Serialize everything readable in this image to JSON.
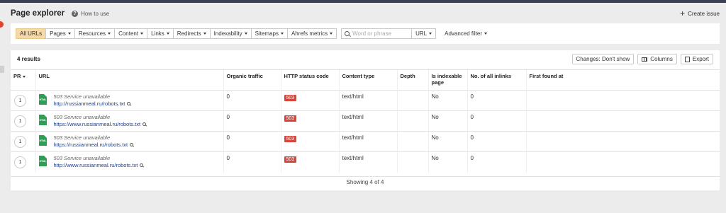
{
  "header": {
    "title": "Page explorer",
    "howto": "How to use",
    "create": "Create issue"
  },
  "filters": {
    "all_urls": "All URLs",
    "pages": "Pages",
    "resources": "Resources",
    "content": "Content",
    "links": "Links",
    "redirects": "Redirects",
    "indexability": "Indexability",
    "sitemaps": "Sitemaps",
    "metrics": "Ahrefs metrics",
    "search_placeholder": "Word or phrase",
    "url_select": "URL",
    "advanced": "Advanced filter"
  },
  "toolbar": {
    "results": "4 results",
    "changes": "Changes: Don't show",
    "columns": "Columns",
    "export": "Export"
  },
  "columns": {
    "pr": "PR",
    "url": "URL",
    "organic": "Organic traffic",
    "status": "HTTP status code",
    "ctype": "Content type",
    "depth": "Depth",
    "indexable": "Is indexable page",
    "inlinks": "No. of all inlinks",
    "first_found": "First found at"
  },
  "rows": [
    {
      "pr": "1",
      "icon_text": "HTML",
      "title": "503 Service unavailable",
      "url": "http://russianmeal.ru/robots.txt",
      "organic": "0",
      "status": "503",
      "ctype": "text/html",
      "depth": "",
      "indexable": "No",
      "inlinks": "0",
      "first_found": ""
    },
    {
      "pr": "1",
      "icon_text": "HTML",
      "title": "503 Service unavailable",
      "url": "https://www.russianmeal.ru/robots.txt",
      "organic": "0",
      "status": "503",
      "ctype": "text/html",
      "depth": "",
      "indexable": "No",
      "inlinks": "0",
      "first_found": ""
    },
    {
      "pr": "1",
      "icon_text": "HTML",
      "title": "503 Service unavailable",
      "url": "https://russianmeal.ru/robots.txt",
      "organic": "0",
      "status": "503",
      "ctype": "text/html",
      "depth": "",
      "indexable": "No",
      "inlinks": "0",
      "first_found": ""
    },
    {
      "pr": "1",
      "icon_text": "HTML",
      "title": "503 Service unavailable",
      "url": "http://www.russianmeal.ru/robots.txt",
      "organic": "0",
      "status": "503",
      "ctype": "text/html",
      "depth": "",
      "indexable": "No",
      "inlinks": "0",
      "first_found": ""
    }
  ],
  "footer": "Showing 4 of 4",
  "colors": {
    "accent": "#f5d9a8",
    "status_error": "#d9453a",
    "link": "#1a3d8f",
    "file_icon": "#2e9e55"
  }
}
